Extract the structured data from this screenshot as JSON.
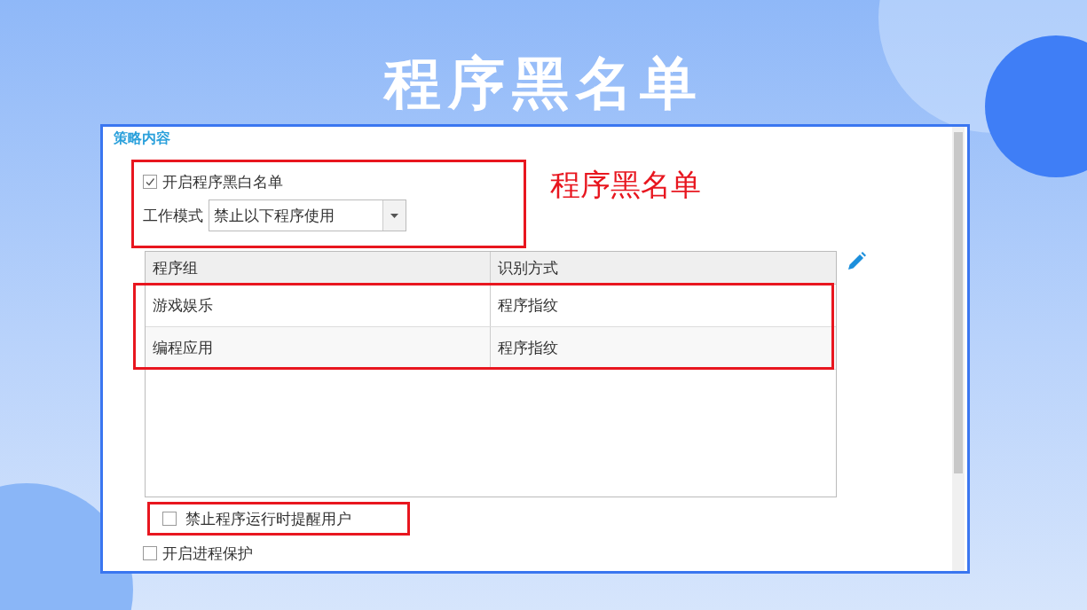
{
  "title": "程序黑名单",
  "panel": {
    "section_label": "策略内容",
    "annotation": "程序黑名单",
    "enable_checkbox": {
      "label": "开启程序黑白名单",
      "checked": true
    },
    "work_mode": {
      "label": "工作模式",
      "value": "禁止以下程序使用"
    },
    "table": {
      "columns": [
        "程序组",
        "识别方式"
      ],
      "rows": [
        [
          "游戏娱乐",
          "程序指纹"
        ],
        [
          "编程应用",
          "程序指纹"
        ]
      ]
    },
    "remind_checkbox": {
      "label": "禁止程序运行时提醒用户",
      "checked": false
    },
    "protect_checkbox": {
      "label": "开启进程保护",
      "checked": false
    }
  }
}
